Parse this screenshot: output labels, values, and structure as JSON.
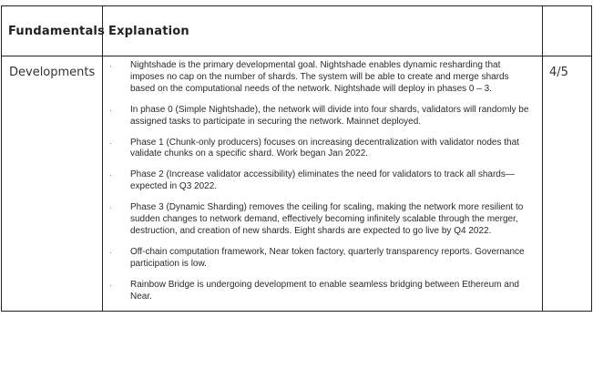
{
  "table": {
    "headers": {
      "fundamentals": "Fundamentals",
      "explanation": "Explanation",
      "score": ""
    },
    "row": {
      "fundamental": "Developments",
      "score": "4/5",
      "bullet_glyph": "·",
      "bullets": [
        "Nightshade is the primary developmental goal. Nightshade enables dynamic resharding that imposes no cap on the number of shards. The system will be able to create and merge shards based on the computational needs of the network. Nightshade will deploy in phases 0 – 3.",
        "In phase 0 (Simple Nightshade), the network will divide into four shards, validators will randomly be assigned tasks to participate in securing the network. Mainnet deployed.",
        "Phase 1 (Chunk-only producers) focuses on increasing decentralization with validator nodes that validate chunks on a specific shard. Work began Jan 2022.",
        "Phase 2 (Increase validator accessibility) eliminates the need for validators to track all shards—expected in Q3 2022.",
        "Phase 3 (Dynamic Sharding) removes the ceiling for scaling, making the network more resilient to sudden changes to network demand, effectively becoming infinitely scalable through the merger, destruction, and creation of new shards. Eight shards are expected to go live by Q4 2022.",
        "Off-chain computation framework, Near token factory, quarterly transparency reports. Governance participation is low.",
        "Rainbow Bridge is undergoing development to enable seamless bridging between Ethereum and Near."
      ]
    }
  }
}
